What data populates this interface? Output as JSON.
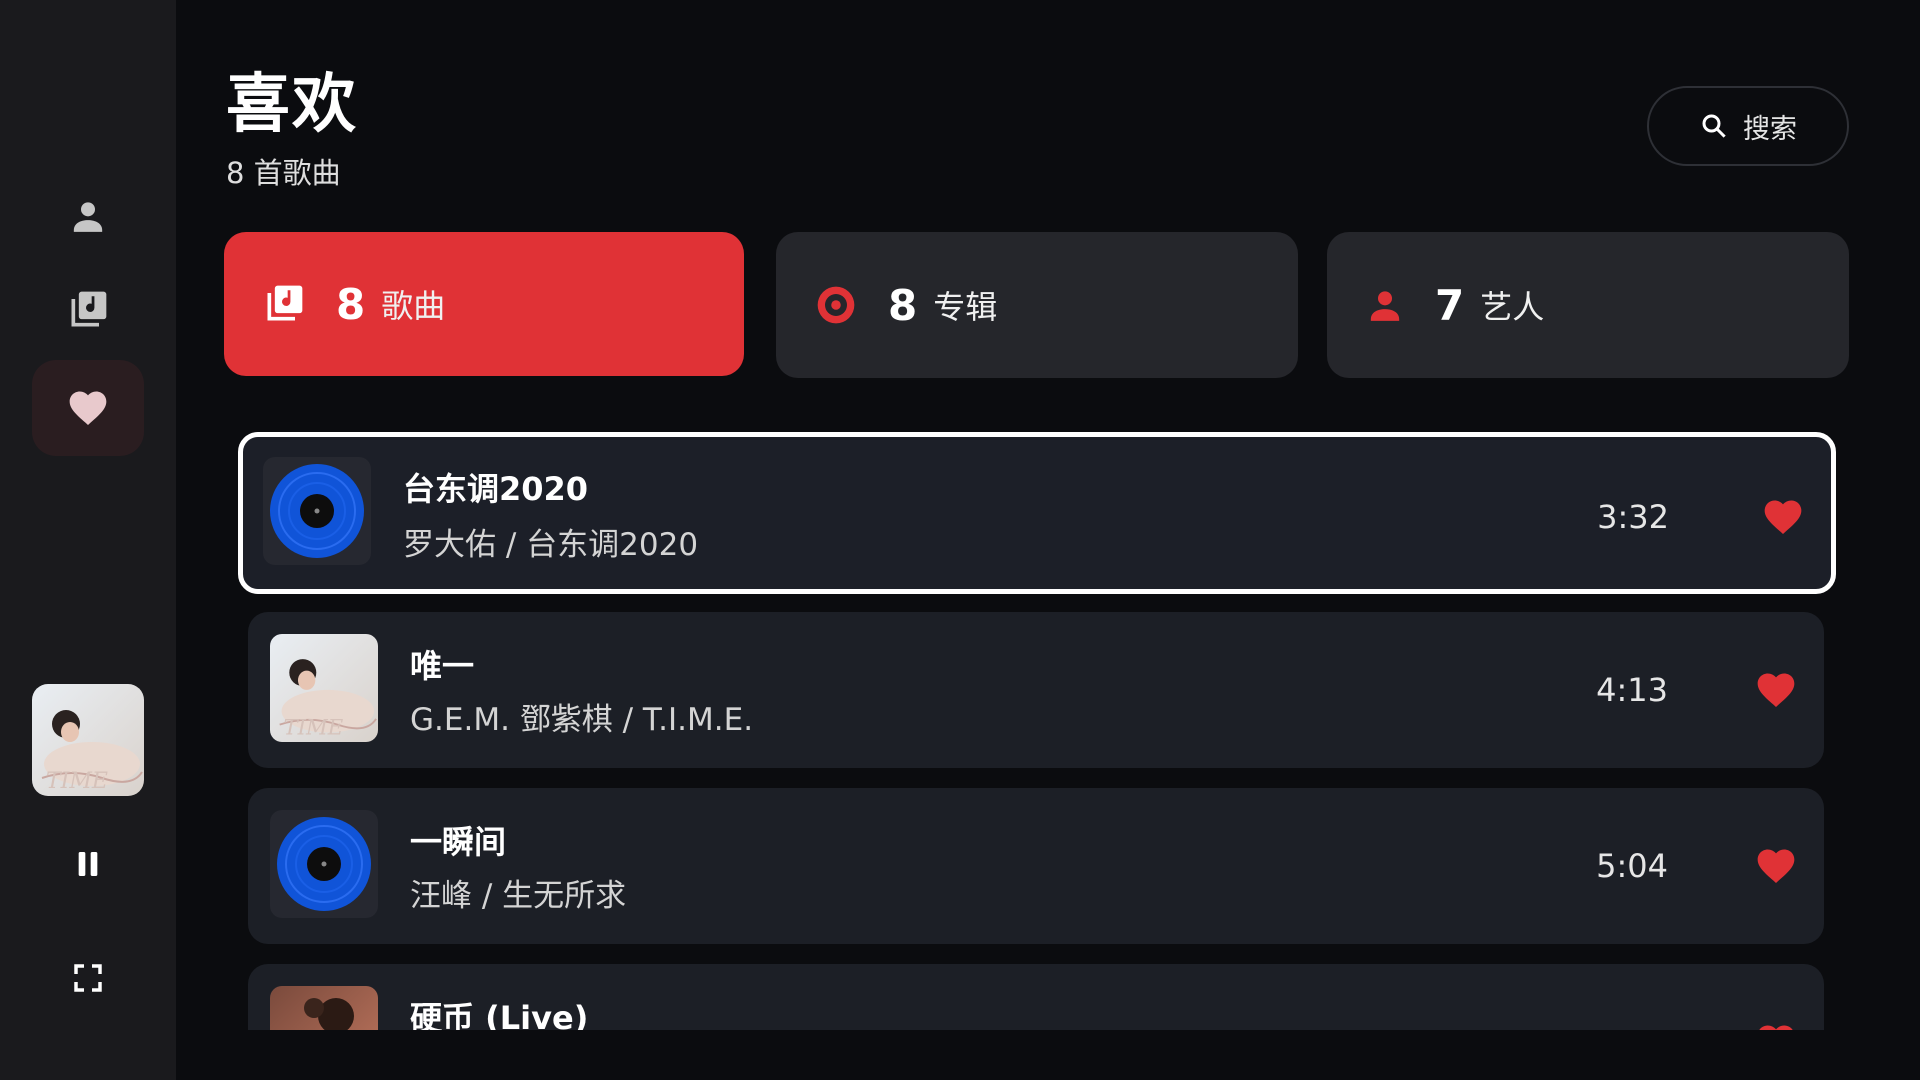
{
  "colors": {
    "accent": "#e03236",
    "background": "#0b0c0f",
    "sidebar": "#1a1a1d",
    "card": "#25262b",
    "row": "#1c1f26"
  },
  "sidebar": {
    "items": [
      {
        "icon": "person-icon",
        "active": false
      },
      {
        "icon": "music-library-icon",
        "active": false
      },
      {
        "icon": "heart-icon",
        "active": true
      }
    ],
    "player": {
      "play_state_icon": "pause-icon",
      "fullscreen_icon": "fullscreen-icon"
    }
  },
  "header": {
    "title": "喜欢",
    "subtitle": "8 首歌曲",
    "search_label": "搜索"
  },
  "stats": [
    {
      "icon": "music-library-icon",
      "count": "8",
      "label": "歌曲",
      "active": true
    },
    {
      "icon": "disc-icon",
      "count": "8",
      "label": "专辑",
      "active": false
    },
    {
      "icon": "person-icon",
      "count": "7",
      "label": "艺人",
      "active": false
    }
  ],
  "songs": [
    {
      "title": "台东调2020",
      "subtitle": "罗大佑 / 台东调2020",
      "duration": "3:32",
      "cover": "vinyl",
      "liked": true
    },
    {
      "title": "唯一",
      "subtitle": "G.E.M. 鄧紫棋 / T.I.M.E.",
      "duration": "4:13",
      "cover": "album-photo",
      "liked": true
    },
    {
      "title": "一瞬间",
      "subtitle": "汪峰 / 生无所求",
      "duration": "5:04",
      "cover": "vinyl",
      "liked": true
    },
    {
      "title": "硬币 (Live)",
      "subtitle": "",
      "duration": "",
      "cover": "album-photo-warm",
      "liked": true
    }
  ]
}
